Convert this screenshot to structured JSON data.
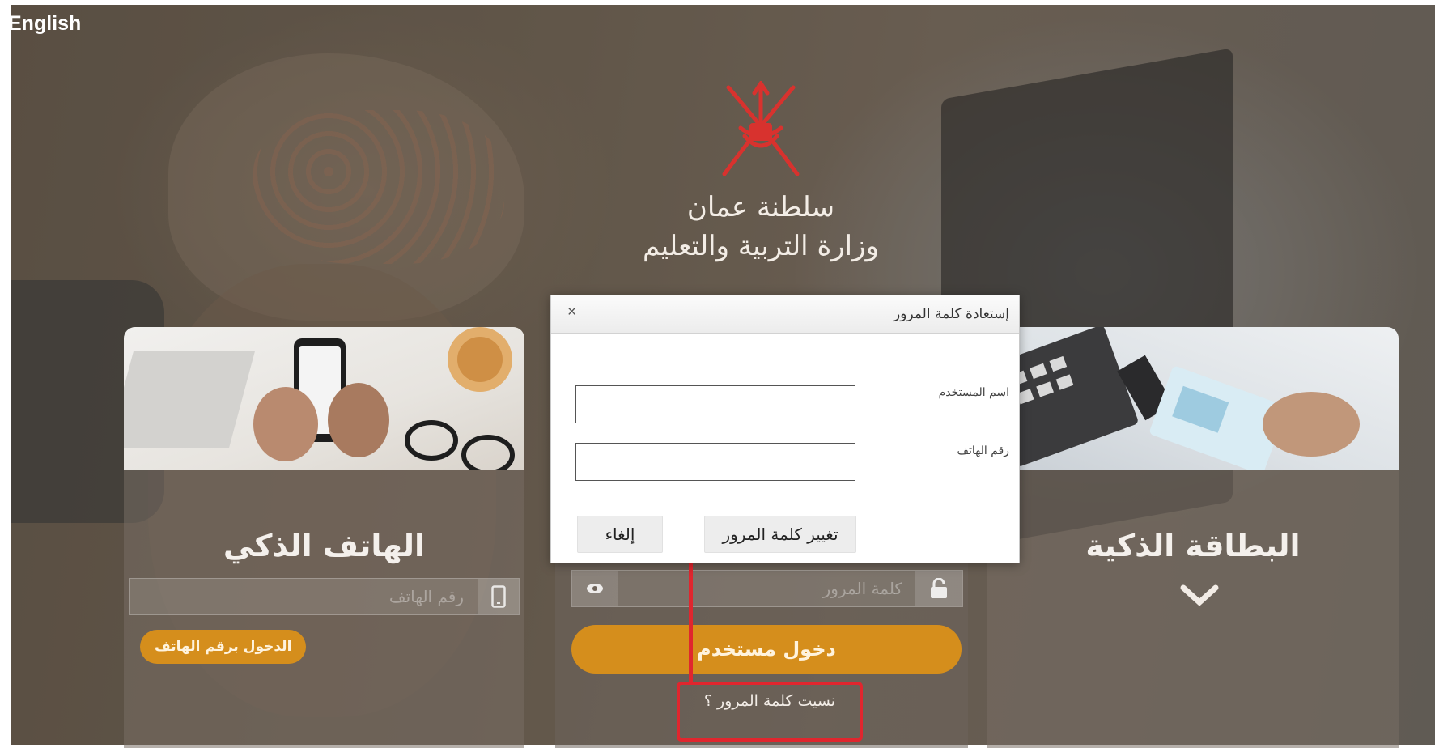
{
  "language_switch": "English",
  "header": {
    "ministry_line1": "سلطنة عمان",
    "ministry_line2": "وزارة التربية والتعليم"
  },
  "cards": {
    "smart_phone": {
      "title": "الهاتف الذكي",
      "phone_placeholder": "رقم الهاتف",
      "login_button": "الدخول برقم الهاتف"
    },
    "user_login": {
      "password_placeholder": "كلمة المرور",
      "login_button": "دخول مستخدم",
      "forgot_link": "نسيت كلمة المرور ؟"
    },
    "smart_card": {
      "title": "البطاقة الذكية"
    }
  },
  "dialog": {
    "title": "إستعادة كلمة المرور",
    "close_label": "×",
    "username_label": "اسم المستخدم",
    "username_value": "",
    "phone_label": "رقم الهاتف",
    "phone_value": "",
    "change_button": "تغيير كلمة المرور",
    "cancel_button": "إلغاء"
  },
  "colors": {
    "accent": "#d58e1c",
    "highlight": "#e0262e",
    "emblem": "#d8322e"
  },
  "icons": [
    "mobile-phone-icon",
    "eye-icon",
    "lock-icon",
    "chevron-down-icon",
    "close-icon",
    "emblem-icon"
  ]
}
